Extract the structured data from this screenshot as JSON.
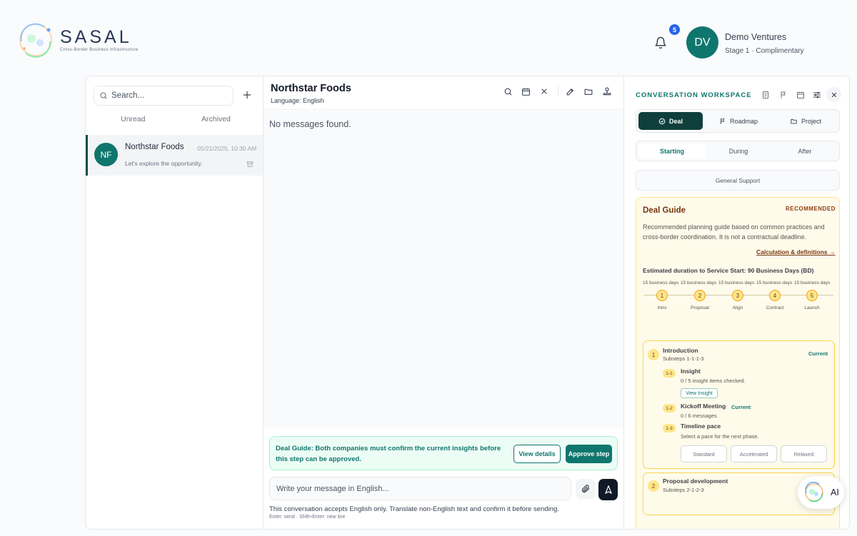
{
  "brand": {
    "name": "SASAL",
    "tagline": "Cross-Border Business Infrastructure"
  },
  "notifications": {
    "count": "5"
  },
  "user": {
    "initials": "DV",
    "name": "Demo Ventures",
    "stage": "Stage 1 · Complimentary"
  },
  "sidebar": {
    "search_placeholder": "Search...",
    "tabs": [
      "Unread",
      "Archived"
    ],
    "conversations": [
      {
        "initials": "NF",
        "name": "Northstar Foods",
        "time": "05/21/2025, 10:30 AM",
        "preview": "Let's explore the opportunity."
      }
    ]
  },
  "chat": {
    "title": "Northstar Foods",
    "language": "Language: English",
    "empty": "No messages found.",
    "guide_text": "Deal Guide: Both companies must confirm the current insights before this step can be approved.",
    "view_details": "View details",
    "approve_step": "Approve step",
    "input_placeholder": "Write your message in English...",
    "hint": "This conversation accepts English only. Translate non-English text and confirm it before sending.",
    "shortcut_hint": "Enter: send · Shift+Enter: new line"
  },
  "workspace": {
    "title": "CONVERSATION WORKSPACE",
    "tabs": [
      "Deal",
      "Roadmap",
      "Project"
    ],
    "phases": [
      "Starting",
      "During",
      "After"
    ],
    "general_support": "General Support",
    "deal_guide": {
      "title": "Deal Guide",
      "badge": "RECOMMENDED",
      "description": "Recommended planning guide based on common practices and cross-border coordination. It is not a contractual deadline.",
      "link": "Calculation & definitions →",
      "estimate": "Estimated duration to Service Start: 90 Business Days (BD)",
      "segments": [
        "15 business days",
        "15 business days",
        "15 business days",
        "15 business days",
        "15 business days"
      ],
      "milestones": [
        {
          "num": "1",
          "label": "Intro"
        },
        {
          "num": "2",
          "label": "Proposal"
        },
        {
          "num": "3",
          "label": "Align"
        },
        {
          "num": "4",
          "label": "Contract"
        },
        {
          "num": "5",
          "label": "Launch"
        }
      ],
      "steps": [
        {
          "num": "1",
          "title": "Introduction",
          "substeps": "Substeps 1-1-1-3",
          "status": "Current",
          "items": [
            {
              "num": "1-1",
              "title": "Insight",
              "desc": "0 / 5 insight items checked.",
              "action": "View Insight"
            },
            {
              "num": "1-2",
              "title": "Kickoff Meeting",
              "status": "Current",
              "desc": "0 / 6 messages"
            },
            {
              "num": "1-3",
              "title": "Timeline pace",
              "desc": "Select a pace for the next phase.",
              "options": [
                "Standard",
                "Accelerated",
                "Relaxed"
              ]
            }
          ]
        },
        {
          "num": "2",
          "title": "Proposal development",
          "substeps": "Substeps 2-1-2-3"
        }
      ]
    }
  },
  "ai": {
    "label": "AI"
  },
  "colors": {
    "brand_teal": "#0f766e",
    "dark_teal": "#0f3f3c",
    "notification_blue": "#2563eb",
    "guide_amber": "#fffbeb"
  }
}
